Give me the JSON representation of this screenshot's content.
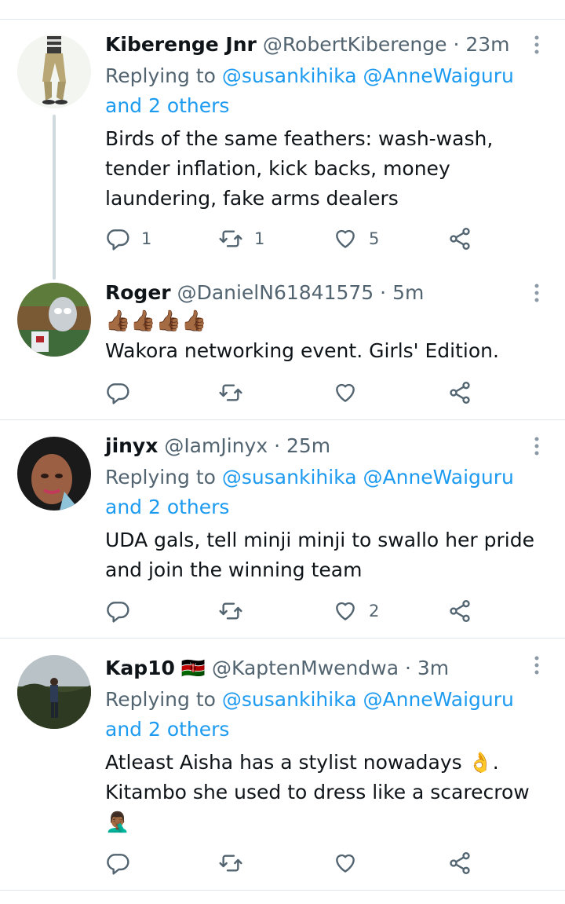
{
  "tweets": [
    {
      "name": "Kiberenge Jnr",
      "handle": "@RobertKiberenge",
      "time": "23m",
      "reply_prefix": "Replying to",
      "reply_users": [
        "@susankihika",
        "@AnneWaiguru"
      ],
      "reply_others": "and 2 others",
      "text": "Birds of the same feathers: wash-wash, tender inflation, kick backs, money laundering, fake arms dealers",
      "replies": "1",
      "retweets": "1",
      "likes": "5"
    },
    {
      "name": "Roger",
      "handle": "@DanielN61841575",
      "time": "5m",
      "emojis": "👍🏾👍🏾👍🏾👍🏾",
      "text": "Wakora networking event. Girls' Edition.",
      "replies": "",
      "retweets": "",
      "likes": ""
    },
    {
      "name": "jinyx",
      "handle": "@IamJinyx",
      "time": "25m",
      "reply_prefix": "Replying to",
      "reply_users": [
        "@susankihika",
        "@AnneWaiguru"
      ],
      "reply_others": "and 2 others",
      "text": "UDA gals, tell minji minji to swallo her pride and join the winning team",
      "replies": "",
      "retweets": "",
      "likes": "2"
    },
    {
      "name": "Kap10",
      "flag": "🇰🇪",
      "handle": "@KaptenMwendwa",
      "time": "3m",
      "reply_prefix": "Replying to",
      "reply_users": [
        "@susankihika",
        "@AnneWaiguru"
      ],
      "reply_others": "and 2 others",
      "text_line1": "Atleast Aisha has a stylist nowadays 👌.",
      "text_line2": "Kitambo she used to dress like a scarecrow",
      "text_line3": "🤦🏾‍♂️",
      "replies": "",
      "retweets": "",
      "likes": ""
    }
  ],
  "separator": "·",
  "icons": [
    "reply-icon",
    "retweet-icon",
    "like-icon",
    "share-icon",
    "more-icon"
  ],
  "colors": {
    "link": "#1d9bf0",
    "muted": "#536471",
    "text": "#0f1419",
    "divider": "#e1e6ea"
  }
}
